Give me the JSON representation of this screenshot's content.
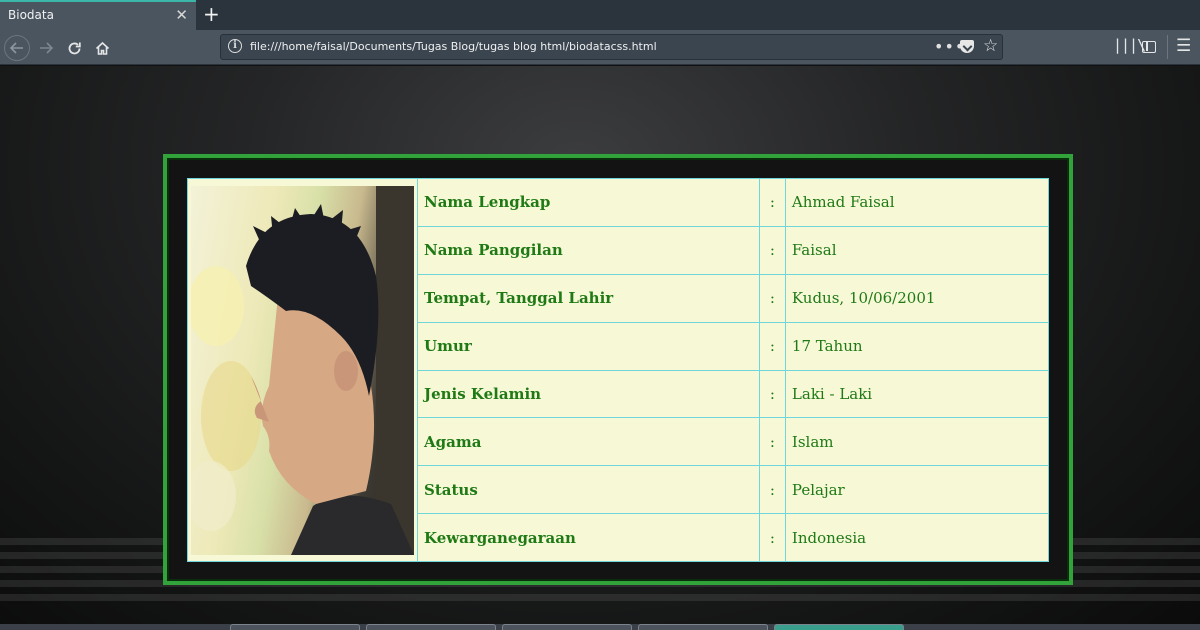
{
  "browser": {
    "tab_title": "Biodata",
    "tab_close": "✕",
    "new_tab": "+",
    "url": "file:///home/faisal/Documents/Tugas Blog/tugas blog html/biodatacss.html",
    "icons": {
      "back": "back-arrow-icon",
      "forward": "forward-arrow-icon",
      "reload": "reload-icon",
      "home": "home-icon",
      "info": "info-icon",
      "more": "more-actions-icon",
      "pocket": "pocket-icon",
      "bookmark": "bookmark-star-icon",
      "library": "library-icon",
      "sidebar": "sidebar-icon",
      "menu": "hamburger-menu-icon"
    }
  },
  "biodata": {
    "separator": ":",
    "rows": [
      {
        "label": "Nama Lengkap",
        "value": "Ahmad Faisal"
      },
      {
        "label": "Nama Panggilan",
        "value": "Faisal"
      },
      {
        "label": "Tempat, Tanggal Lahir",
        "value": "Kudus, 10/06/2001"
      },
      {
        "label": "Umur",
        "value": "17 Tahun"
      },
      {
        "label": "Jenis Kelamin",
        "value": "Laki - Laki"
      },
      {
        "label": "Agama",
        "value": "Islam"
      },
      {
        "label": "Status",
        "value": "Pelajar"
      },
      {
        "label": "Kewarganegaraan",
        "value": "Indonesia"
      }
    ]
  },
  "colors": {
    "card_border": "#32a33a",
    "table_background": "#f7f8d6",
    "table_grid": "#6fd7dc",
    "text": "#1f7a16",
    "chrome": "#4a5560"
  }
}
